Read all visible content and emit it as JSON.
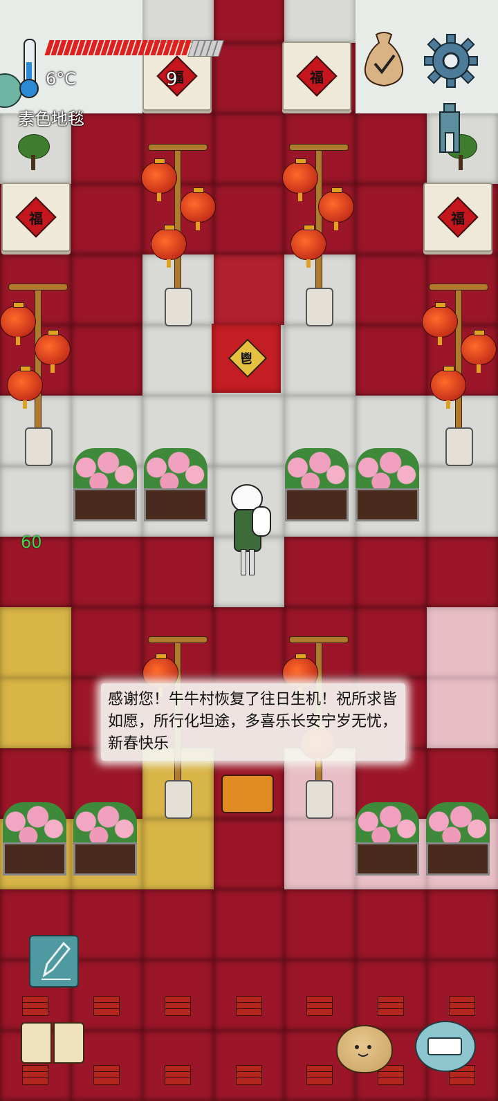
{
  "hud": {
    "temperature": "6°C",
    "current_floor": "素色地毯",
    "health_percent": 82,
    "badge_count": "9",
    "buff_timer": "60"
  },
  "dialogue": {
    "text": "感谢您！牛牛村恢复了往日生机！祝所求皆如愿，所行化坦途，多喜乐长安宁岁无忧，新春快乐"
  },
  "fu_char": "福",
  "stand_char": "鬯",
  "colors": {
    "carpet_red": "#9b1628",
    "carpet_white": "#d9d9d5",
    "carpet_yellow": "#d9b547",
    "carpet_pink": "#e9bfc7",
    "health_red": "#e0201e",
    "timer_green": "#3bd84b"
  },
  "icons": [
    "thermometer-icon",
    "sack-check-icon",
    "gear-icon",
    "tower-icon",
    "pencil-icon",
    "journal-icon",
    "potato-face-icon",
    "keyboard-icon"
  ],
  "map": {
    "rows": [
      [
        "snow",
        "snow",
        "white",
        "red",
        "white",
        "snow",
        "snow"
      ],
      [
        "snow",
        "snow",
        "red",
        "red",
        "red",
        "snow",
        "snow"
      ],
      [
        "white",
        "red",
        "red",
        "red",
        "red",
        "red",
        "white"
      ],
      [
        "red",
        "red",
        "red",
        "red",
        "red",
        "red",
        "red"
      ],
      [
        "red",
        "red",
        "white",
        "darkred",
        "white",
        "red",
        "red"
      ],
      [
        "red",
        "red",
        "white",
        "white",
        "white",
        "red",
        "red"
      ],
      [
        "white",
        "white",
        "white",
        "white",
        "white",
        "white",
        "white"
      ],
      [
        "white",
        "white",
        "white",
        "white",
        "white",
        "white",
        "white"
      ],
      [
        "red",
        "red",
        "red",
        "white",
        "red",
        "red",
        "red"
      ],
      [
        "yellow",
        "red",
        "red",
        "red",
        "red",
        "red",
        "pink"
      ],
      [
        "yellow",
        "red",
        "red",
        "red",
        "red",
        "red",
        "pink"
      ],
      [
        "red",
        "red",
        "yellow",
        "red",
        "pink",
        "red",
        "red"
      ],
      [
        "yellow",
        "yellow",
        "yellow",
        "red",
        "pink",
        "pink",
        "pink"
      ],
      [
        "red",
        "red",
        "red",
        "red",
        "red",
        "red",
        "red"
      ],
      [
        "red",
        "red",
        "red",
        "red",
        "red",
        "red",
        "red"
      ],
      [
        "red",
        "red",
        "red",
        "red",
        "red",
        "red",
        "red"
      ]
    ]
  }
}
